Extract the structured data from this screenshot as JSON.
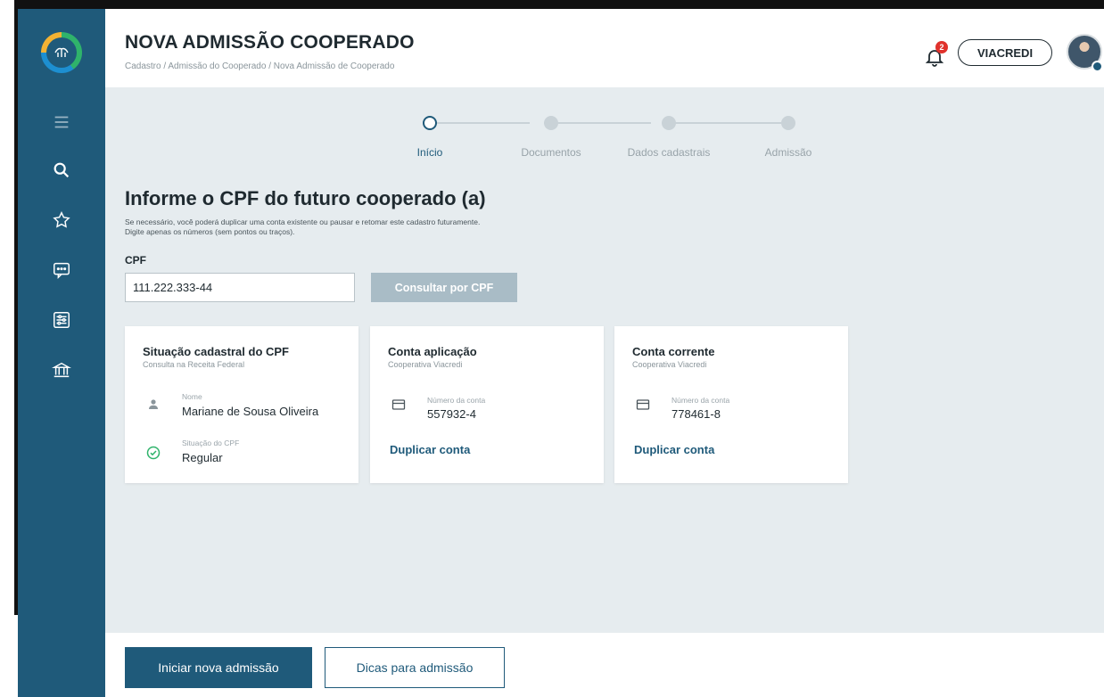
{
  "header": {
    "title": "NOVA ADMISSÃO COOPERADO",
    "breadcrumb": "Cadastro / Admissão do Cooperado / Nova Admissão de Cooperado",
    "notification_count": "2",
    "org_name": "VIACREDI"
  },
  "sidebar": {
    "items": [
      {
        "icon": "menu-icon"
      },
      {
        "icon": "search-icon"
      },
      {
        "icon": "star-icon"
      },
      {
        "icon": "chat-icon"
      },
      {
        "icon": "filter-icon"
      },
      {
        "icon": "bank-icon"
      }
    ]
  },
  "stepper": {
    "steps": [
      "Início",
      "Documentos",
      "Dados cadastrais",
      "Admissão"
    ],
    "active_index": 0
  },
  "form": {
    "heading": "Informe o CPF do futuro cooperado (a)",
    "hint_line1": "Se necessário, você poderá duplicar uma conta existente ou pausar e retomar este cadastro futuramente.",
    "hint_line2": "Digite apenas os números (sem pontos ou traços).",
    "cpf_label": "CPF",
    "cpf_value": "111.222.333-44",
    "consult_button": "Consultar por CPF"
  },
  "cards": {
    "situacao": {
      "title": "Situação cadastral do CPF",
      "subtitle": "Consulta na Receita Federal",
      "name_label": "Nome",
      "name_value": "Mariane de Sousa Oliveira",
      "status_label": "Situação do CPF",
      "status_value": "Regular"
    },
    "aplicacao": {
      "title": "Conta aplicação",
      "subtitle": "Cooperativa Viacredi",
      "account_label": "Número da conta",
      "account_value": "557932-4",
      "link": "Duplicar conta"
    },
    "corrente": {
      "title": "Conta corrente",
      "subtitle": "Cooperativa Viacredi",
      "account_label": "Número da conta",
      "account_value": "778461-8",
      "link": "Duplicar conta"
    }
  },
  "footer": {
    "primary_button": "Iniciar nova admissão",
    "secondary_button": "Dicas para admissão"
  },
  "colors": {
    "sidebar": "#1f5a7a",
    "background": "#e6ecef",
    "accent": "#1f5a7a",
    "success": "#2fb36b",
    "badge": "#e0322c"
  }
}
